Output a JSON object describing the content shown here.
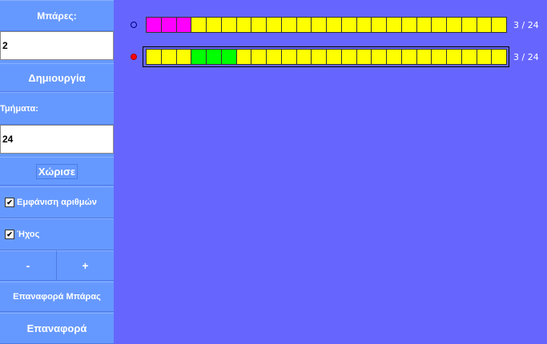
{
  "sidebar": {
    "bars_label": "Μπάρες:",
    "bars_value": "2",
    "create_label": "Δημιουργία",
    "segments_label": "Τμήματα:",
    "segments_value": "24",
    "split_label": "Χώρισε",
    "show_numbers_label": "Εμφάνιση αριθμών",
    "show_numbers_checked": true,
    "sound_label": "Ήχος",
    "sound_checked": true,
    "minus_label": "-",
    "plus_label": "+",
    "reset_bar_label": "Επαναφορά Μπάρας",
    "reset_label": "Επαναφορά",
    "check_glyph": "✔"
  },
  "colors": {
    "background": "#6666ff",
    "sidebar": "#6699ff",
    "segment_empty": "#ffff00",
    "radio_selected": "#ff0000"
  },
  "bars": [
    {
      "selected": false,
      "segments": 24,
      "count_text": "3 / 24",
      "colored": [
        {
          "index": 0,
          "color": "#ff00ff"
        },
        {
          "index": 1,
          "color": "#ff00ff"
        },
        {
          "index": 2,
          "color": "#ff00ff"
        }
      ]
    },
    {
      "selected": true,
      "segments": 24,
      "count_text": "3 / 24",
      "colored": [
        {
          "index": 3,
          "color": "#00ff00"
        },
        {
          "index": 4,
          "color": "#00ff00"
        },
        {
          "index": 5,
          "color": "#00ff00"
        }
      ]
    }
  ]
}
